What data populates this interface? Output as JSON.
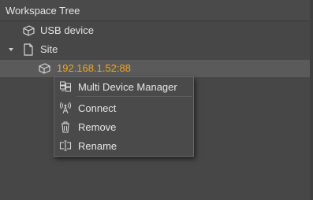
{
  "panel": {
    "title": "Workspace Tree"
  },
  "tree": {
    "items": [
      {
        "label": "USB device",
        "icon": "device-box-icon"
      },
      {
        "label": "Site",
        "icon": "page-icon",
        "expanded": true
      },
      {
        "label": "192.168.1.52:88",
        "icon": "device-box-icon",
        "selected": true
      }
    ]
  },
  "context_menu": {
    "items": [
      {
        "label": "Multi Device Manager",
        "icon": "multi-device-icon"
      },
      {
        "label": "Connect",
        "icon": "antenna-icon"
      },
      {
        "label": "Remove",
        "icon": "trash-icon"
      },
      {
        "label": "Rename",
        "icon": "rename-icon"
      }
    ]
  },
  "colors": {
    "background": "#474747",
    "selected_row": "#5a5a5a",
    "selected_text": "#f2a51c",
    "text": "#e3e3e3"
  }
}
